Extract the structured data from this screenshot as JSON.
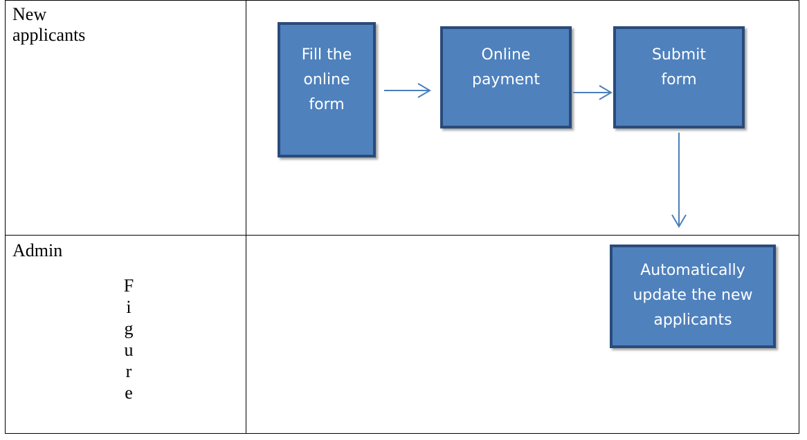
{
  "lanes": {
    "top_label": "New\napplicants",
    "bottom_label": "Admin",
    "bottom_vertical_text": [
      "F",
      "i",
      "g",
      "u",
      "r",
      "e"
    ]
  },
  "boxes": {
    "fill_form": "Fill the\nonline\nform",
    "online_payment": "Online\npayment",
    "submit_form": "Submit\nform",
    "auto_update": "Automatically\nupdate the new\napplicants"
  },
  "colors": {
    "box_fill": "#4f81bd",
    "box_border": "#2a4b7a",
    "arrow": "#4a7ebb"
  }
}
